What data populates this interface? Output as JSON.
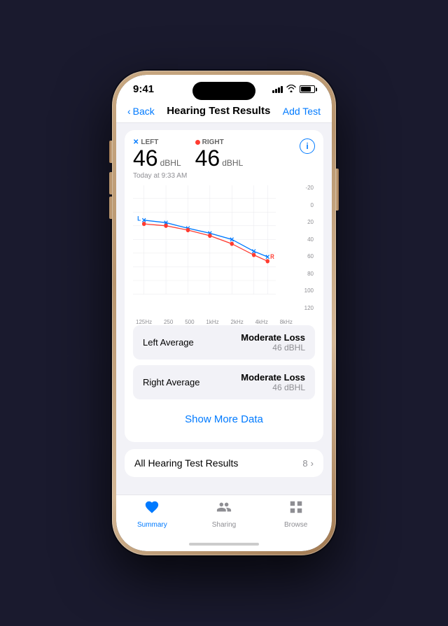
{
  "statusBar": {
    "time": "9:41",
    "batteryLevel": 80
  },
  "navBar": {
    "backLabel": "Back",
    "title": "Hearing Test Results",
    "actionLabel": "Add Test"
  },
  "hearingCard": {
    "leftLabel": "LEFT",
    "leftMarker": "×",
    "leftValue": "46",
    "leftUnit": "dBHL",
    "rightLabel": "RIGHT",
    "rightValue": "46",
    "rightUnit": "dBHL",
    "date": "Today at 9:33 AM"
  },
  "chart": {
    "yLabels": [
      "-20",
      "0",
      "20",
      "40",
      "60",
      "80",
      "100",
      "120"
    ],
    "xLabels": [
      "125Hz",
      "250",
      "500",
      "1kHz",
      "2kHz",
      "4kHz",
      "8kHz"
    ]
  },
  "results": [
    {
      "label": "Left Average",
      "severity": "Moderate Loss",
      "value": "46 dBHL"
    },
    {
      "label": "Right Average",
      "severity": "Moderate Loss",
      "value": "46 dBHL"
    }
  ],
  "showMore": {
    "label": "Show More Data"
  },
  "allResults": {
    "label": "All Hearing Test Results",
    "count": "8",
    "chevron": "›"
  },
  "tabBar": {
    "tabs": [
      {
        "id": "summary",
        "label": "Summary",
        "active": true
      },
      {
        "id": "sharing",
        "label": "Sharing",
        "active": false
      },
      {
        "id": "browse",
        "label": "Browse",
        "active": false
      }
    ]
  }
}
